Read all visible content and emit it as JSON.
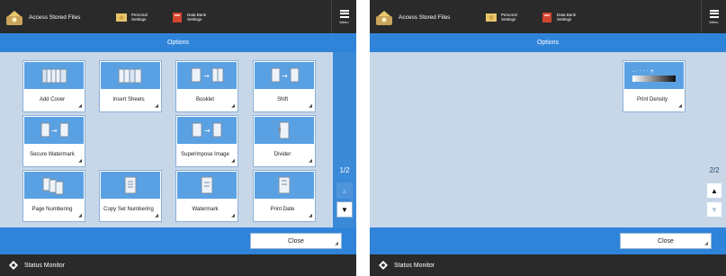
{
  "topbar": {
    "home_label": "Access Stored Files",
    "personal_label": "Personal Settings",
    "shared_label": "Data Bank Settings",
    "menu_label": "Menu"
  },
  "header": {
    "title": "Options"
  },
  "left": {
    "options": [
      {
        "label": "Add Cover"
      },
      {
        "label": "Insert Sheets"
      },
      {
        "label": "Booklet"
      },
      {
        "label": "Shift"
      },
      {
        "label": "Secure Watermark"
      },
      {
        "label": "Superimpose Image"
      },
      {
        "label": "Divider"
      },
      {
        "label": "Page Numbering"
      },
      {
        "label": "Copy Set Numbering"
      },
      {
        "label": "Watermark"
      },
      {
        "label": "Print Date"
      }
    ],
    "page_indicator": "1/2"
  },
  "right": {
    "options": [
      {
        "label": "Print Density"
      }
    ],
    "page_indicator": "2/2"
  },
  "buttons": {
    "close": "Close"
  },
  "bottom": {
    "status_monitor": "Status Monitor"
  },
  "colors": {
    "accent": "#2f84d9",
    "dark": "#2a2a2a",
    "panel": "#c8d7e8",
    "tile": "#5aa1e3"
  }
}
